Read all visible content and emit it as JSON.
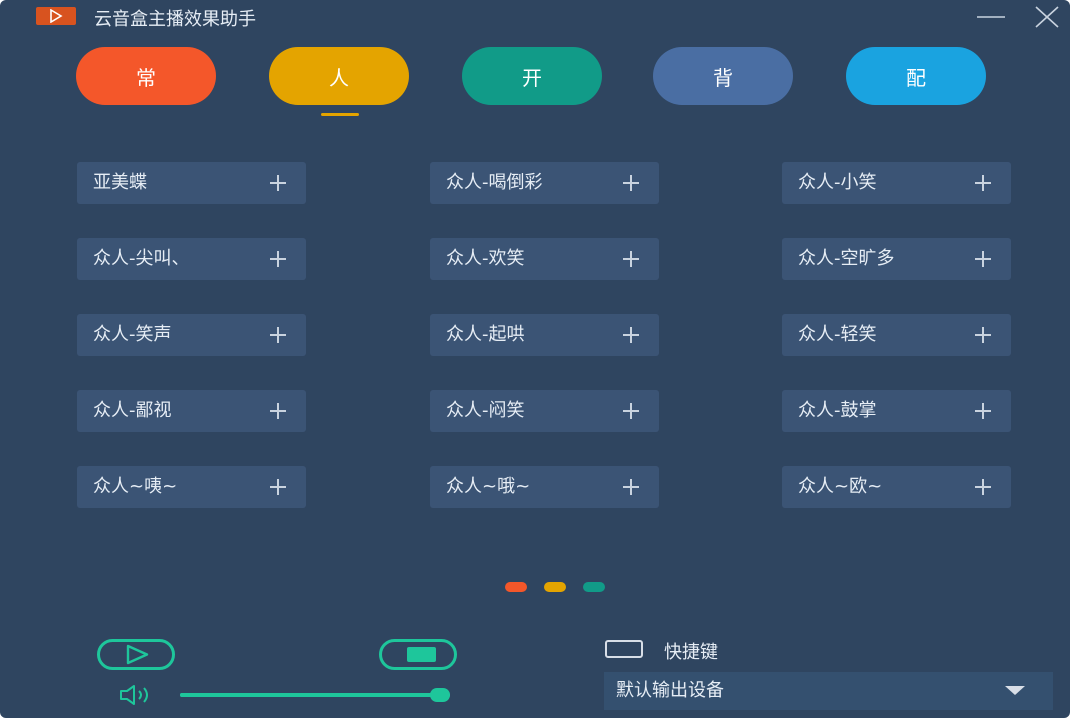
{
  "app": {
    "title": "云音盒主播效果助手"
  },
  "tabs": [
    {
      "label": "常",
      "color": "#f4572a"
    },
    {
      "label": "人",
      "color": "#e4a400",
      "active": true
    },
    {
      "label": "开",
      "color": "#119b88"
    },
    {
      "label": "背",
      "color": "#4a6ea3"
    },
    {
      "label": "配",
      "color": "#1aa3e0"
    }
  ],
  "sounds": [
    [
      "亚美蝶",
      "众人-喝倒彩",
      "众人-小笑"
    ],
    [
      "众人-尖叫、",
      "众人-欢笑",
      "众人-空旷多"
    ],
    [
      "众人-笑声",
      "众人-起哄",
      "众人-轻笑"
    ],
    [
      "众人-鄙视",
      "众人-闷笑",
      "众人-鼓掌"
    ],
    [
      "众人~咦~",
      "众人~哦~",
      "众人~欧~"
    ]
  ],
  "pagination": {
    "dots": [
      {
        "color": "#f4572a"
      },
      {
        "color": "#e4a400"
      },
      {
        "color": "#119b88"
      }
    ]
  },
  "controls": {
    "volume": 1.0,
    "accent": "#1ec69b"
  },
  "hotkey": {
    "label": "快捷键",
    "checked": false
  },
  "device": {
    "selected": "默认输出设备"
  },
  "colors": {
    "background": "#2f4560",
    "item": "#3b5475",
    "text": "#e6edf5"
  }
}
